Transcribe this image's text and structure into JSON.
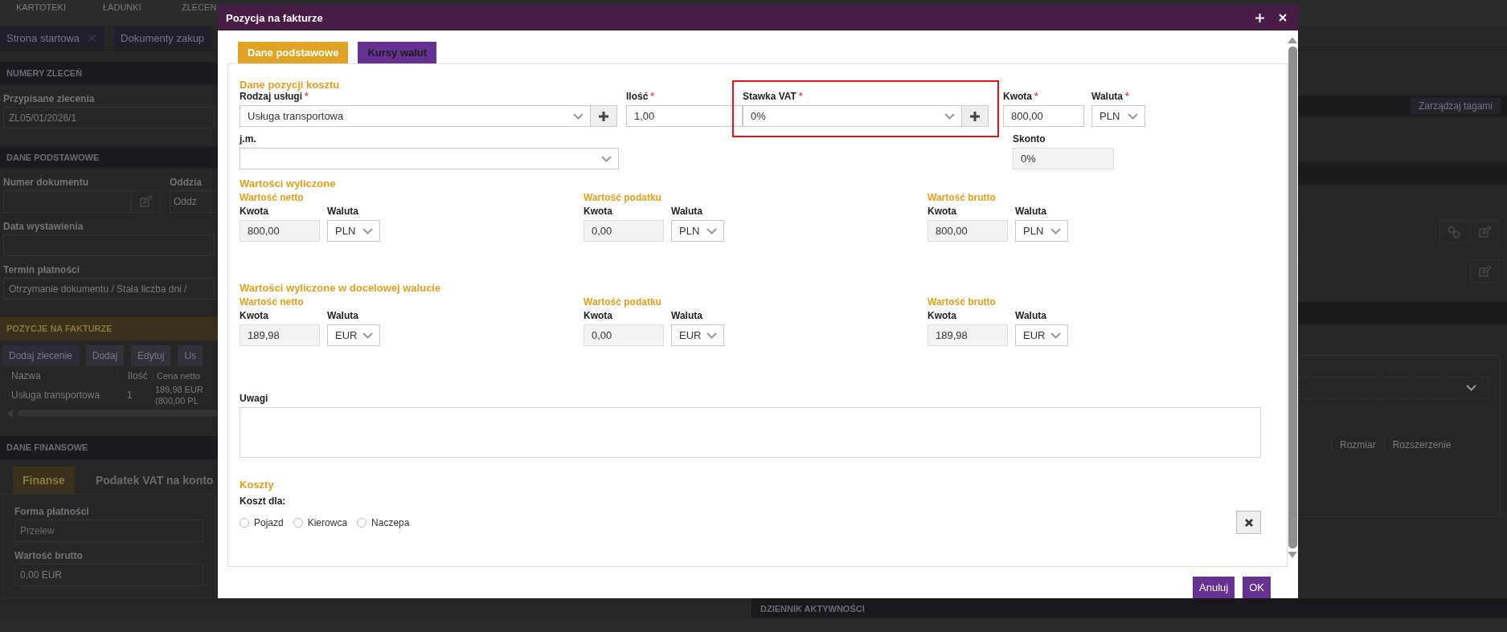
{
  "app": {
    "menu": [
      "KARTOTEKI",
      "ŁADUNKI",
      "ZLECEN"
    ],
    "tabs": [
      {
        "label": "Strona startowa",
        "closable": true
      },
      {
        "label": "Dokumenty zakup",
        "closable": false
      }
    ],
    "orders": {
      "header": "NUMERY ZLECEŃ",
      "label": "Przypisane zlecenia",
      "value": "ZL05/01/2026/1"
    },
    "basic": {
      "header": "DANE PODSTAWOWE",
      "doc_label": "Numer dokumentu",
      "branch_label": "Oddzia",
      "branch_value": "Oddz",
      "date_label": "Data wystawienia",
      "term_label": "Termin płatności",
      "term_value": "Otrzymanie dokumentu / Stała liczba dni /"
    },
    "items": {
      "header": "POZYCJE NA FAKTURZE",
      "buttons": [
        "Dodaj zlecenie",
        "Dodaj",
        "Edytuj",
        "Us"
      ],
      "columns": [
        "Nazwa",
        "Ilość",
        "Cena netto"
      ],
      "rows": [
        [
          "Usługa transportowa",
          "1",
          "189,98 EUR",
          "(800,00 PL"
        ]
      ]
    },
    "finance": {
      "header": "DANE FINANSOWE",
      "tabs": [
        {
          "label": "Finanse",
          "selected": true
        },
        {
          "label": "Podatek VAT na konto",
          "selected": false
        }
      ],
      "payment_label": "Forma płatności",
      "payment_value": "Przelew",
      "gross_label": "Wartość brutto",
      "gross_value": "0,00 EUR"
    },
    "tags_button": "Zarządzaj tagami",
    "file_columns": [
      "Rozmiar",
      "Rozszerzenie"
    ],
    "log_header": "DZIENNIK AKTYWNOŚCI"
  },
  "dialog": {
    "title": "Pozycja na fakturze",
    "tabs": [
      {
        "label": "Dane podstawowe",
        "selected": true
      },
      {
        "label": "Kursy walut",
        "selected": false
      }
    ],
    "section_title": "Dane pozycji kosztu",
    "required_mark": "*",
    "cost_fields": [
      {
        "label": "Rodzaj usługi",
        "required": true,
        "kind": "select_add",
        "value": "Usługa transportowa",
        "highlighted": false
      },
      {
        "label": "Ilość",
        "required": true,
        "kind": "input",
        "value": "1,00",
        "highlighted": false
      },
      {
        "label": "Stawka VAT",
        "required": true,
        "kind": "select_add",
        "value": "0%",
        "highlighted": true
      },
      {
        "label": "Kwota",
        "required": true,
        "kind": "input",
        "value": "800,00",
        "highlighted": false
      },
      {
        "label": "Waluta",
        "required": true,
        "kind": "select",
        "value": "PLN",
        "highlighted": false
      }
    ],
    "unit_fields": [
      {
        "label": "j.m.",
        "required": false,
        "kind": "select",
        "readonly": false
      },
      {
        "label": "Skonto",
        "required": false,
        "kind": "input",
        "value": "0%",
        "readonly": true
      }
    ],
    "computed_groups": [
      {
        "title": "Wartości wyliczone",
        "columns": [
          {
            "title": "Wartość netto",
            "amount_label": "Kwota",
            "amount": "800,00",
            "currency_label": "Waluta",
            "currency": "PLN"
          },
          {
            "title": "Wartość podatku",
            "amount_label": "Kwota",
            "amount": "0,00",
            "currency_label": "Waluta",
            "currency": "PLN"
          },
          {
            "title": "Wartość brutto",
            "amount_label": "Kwota",
            "amount": "800,00",
            "currency_label": "Waluta",
            "currency": "PLN"
          }
        ]
      },
      {
        "title": "Wartości wyliczone w docelowej walucie",
        "columns": [
          {
            "title": "Wartość netto",
            "amount_label": "Kwota",
            "amount": "189,98",
            "currency_label": "Waluta",
            "currency": "EUR"
          },
          {
            "title": "Wartość podatku",
            "amount_label": "Kwota",
            "amount": "0,00",
            "currency_label": "Waluta",
            "currency": "EUR"
          },
          {
            "title": "Wartość brutto",
            "amount_label": "Kwota",
            "amount": "189,98",
            "currency_label": "Waluta",
            "currency": "EUR"
          }
        ]
      }
    ],
    "notes_label": "Uwagi",
    "costs_title": "Koszty",
    "cost_for_label": "Koszt dla:",
    "cost_for_options": [
      {
        "label": "Pojazd",
        "selected": false
      },
      {
        "label": "Kierowca",
        "selected": false
      },
      {
        "label": "Naczepa",
        "selected": false
      }
    ],
    "buttons": [
      "Anuluj",
      "OK"
    ]
  }
}
